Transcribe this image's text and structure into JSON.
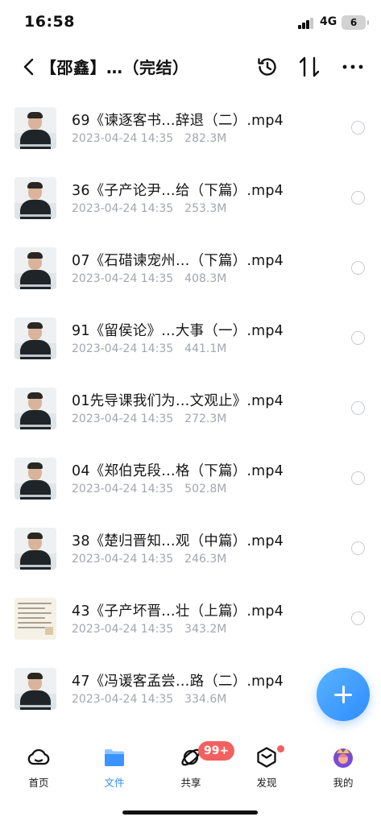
{
  "status_bar": {
    "time": "16:58",
    "network": "4G",
    "battery": "6"
  },
  "header": {
    "title": "【邵鑫】…（完结）",
    "icons": [
      "back-arrow",
      "history-clock",
      "sort-arrows",
      "more-dots"
    ]
  },
  "files": [
    {
      "name": "69《谏逐客书…辞退（二）.mp4",
      "date": "2023-04-24 14:35",
      "size": "282.3M",
      "thumb": "video"
    },
    {
      "name": "36《子产论尹…给（下篇）.mp4",
      "date": "2023-04-24 14:35",
      "size": "253.3M",
      "thumb": "video"
    },
    {
      "name": "07《石碏谏宠州…（下篇）.mp4",
      "date": "2023-04-24 14:35",
      "size": "408.3M",
      "thumb": "video"
    },
    {
      "name": "91《留侯论》…大事（一）.mp4",
      "date": "2023-04-24 14:35",
      "size": "441.1M",
      "thumb": "video"
    },
    {
      "name": "01先导课我们为…文观止》.mp4",
      "date": "2023-04-24 14:35",
      "size": "272.3M",
      "thumb": "video"
    },
    {
      "name": "04《郑伯克段…格（下篇）.mp4",
      "date": "2023-04-24 14:35",
      "size": "502.8M",
      "thumb": "video"
    },
    {
      "name": "38《楚归晋知…观（中篇）.mp4",
      "date": "2023-04-24 14:35",
      "size": "246.3M",
      "thumb": "video"
    },
    {
      "name": "43《子产坏晋…壮（上篇）.mp4",
      "date": "2023-04-24 14:35",
      "size": "343.2M",
      "thumb": "document"
    },
    {
      "name": "47《冯谖客孟尝…路（二）.mp4",
      "date": "2023-04-24 14:35",
      "size": "334.6M",
      "thumb": "video"
    }
  ],
  "bottom_nav": {
    "items": [
      {
        "label": "首页",
        "icon": "cloud-icon",
        "active": false
      },
      {
        "label": "文件",
        "icon": "folder-icon",
        "active": true
      },
      {
        "label": "共享",
        "icon": "share-planet-icon",
        "active": false
      },
      {
        "label": "发现",
        "icon": "cube-icon",
        "active": false
      },
      {
        "label": "我的",
        "icon": "avatar-icon",
        "active": false
      }
    ],
    "share_badge": "99+"
  },
  "colors": {
    "accent": "#2f8cff",
    "badge": "#f26060",
    "meta_text": "#a3a7ad"
  }
}
